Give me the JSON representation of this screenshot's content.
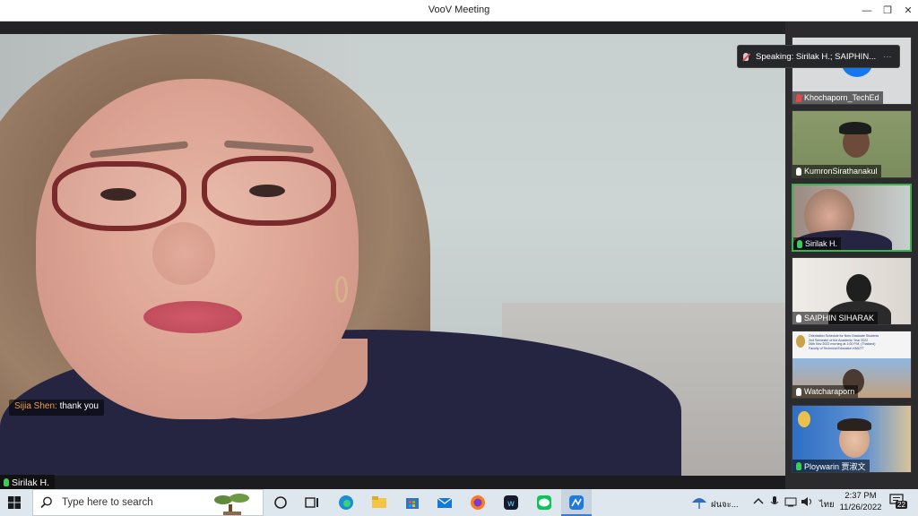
{
  "window": {
    "title": "VooV Meeting",
    "minimize": "—",
    "restore": "❐",
    "close": "✕"
  },
  "main": {
    "speaker_name": "Sirilak H.",
    "chat": {
      "sender": "Sijia Shen:",
      "text": "thank you"
    }
  },
  "speaking_banner": {
    "text": "Speaking: Sirilak H.; SAIPHIN...",
    "more": "···"
  },
  "participants": [
    {
      "name": "Khochaporn_TechEd",
      "mic": "muted"
    },
    {
      "name": "KumronSirathanakul",
      "mic": "on"
    },
    {
      "name": "Sirilak H.",
      "mic": "active"
    },
    {
      "name": "SAIPHIN SIHARAK",
      "mic": "on"
    },
    {
      "name": "Watcharaporn",
      "mic": "on"
    },
    {
      "name": "Ploywarin 贾淑文",
      "mic": "active"
    }
  ],
  "slide_tile": {
    "line1": "Orientation Schedule for New Graduate Students",
    "line2": "2nd Semester of the Academic Year 2022",
    "line3": "26th Nov 2022 morning at 1:00 P.M. (Thailand)",
    "line4": "Faculty of Technical Education KMUTT"
  },
  "taskbar": {
    "search_placeholder": "Type here to search",
    "weather": "ฝนจะ...",
    "lang": "ไทย",
    "time": "2:37 PM",
    "date": "11/26/2022",
    "notifications": "22"
  },
  "colors": {
    "accent_green": "#3ecb55",
    "speaking_border": "#3bb24a",
    "chat_sender": "#f0a040",
    "avatar_blue": "#1479f0"
  }
}
